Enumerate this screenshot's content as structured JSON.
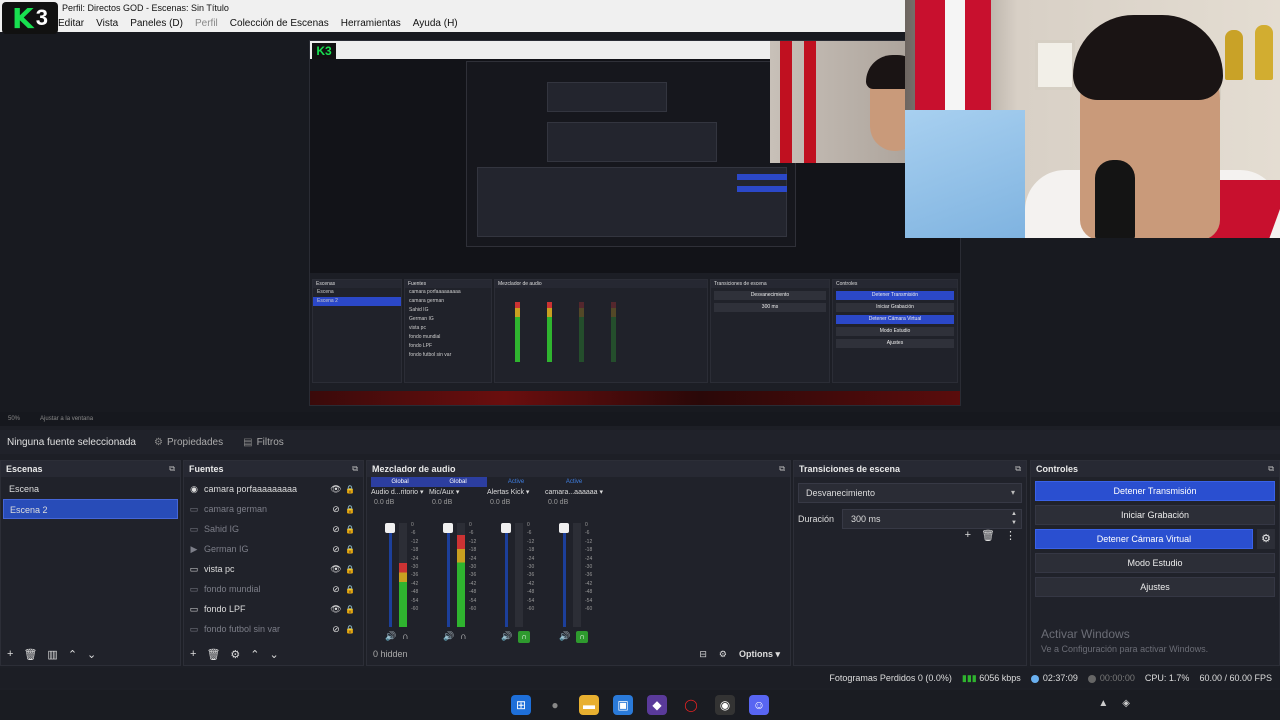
{
  "window": {
    "title": "Perfil: Directos GOD - Escenas: Sin Título",
    "logo_k": "K",
    "logo_num": "3"
  },
  "menubar": {
    "items": [
      "Editar",
      "Vista",
      "Paneles (D)",
      "Perfil",
      "Colección de Escenas",
      "Herramientas",
      "Ayuda (H)"
    ]
  },
  "zoom": {
    "level": "50%",
    "mode": "Ajustar a la ventana"
  },
  "source_toolbar": {
    "no_selection": "Ninguna fuente seleccionada",
    "properties": "Propiedades",
    "filters": "Filtros"
  },
  "scenes": {
    "title": "Escenas",
    "items": [
      "Escena",
      "Escena 2"
    ],
    "selected": "Escena 2"
  },
  "sources": {
    "title": "Fuentes",
    "items": [
      {
        "label": "camara porfaaaaaaaaa",
        "icon": "camera-icon",
        "visible": true,
        "locked": true
      },
      {
        "label": "camara german",
        "icon": "window-icon",
        "visible": false,
        "locked": true
      },
      {
        "label": "Sahid IG",
        "icon": "window-icon",
        "visible": false,
        "locked": true
      },
      {
        "label": "German IG",
        "icon": "play-icon",
        "visible": false,
        "locked": true
      },
      {
        "label": "vista pc",
        "icon": "window-icon",
        "visible": true,
        "locked": true
      },
      {
        "label": "fondo mundial",
        "icon": "window-icon",
        "visible": false,
        "locked": true
      },
      {
        "label": "fondo LPF",
        "icon": "window-icon",
        "visible": true,
        "locked": true
      },
      {
        "label": "fondo futbol sin var",
        "icon": "window-icon",
        "visible": false,
        "locked": true
      }
    ]
  },
  "mixer": {
    "title": "Mezclador de audio",
    "hidden_count": "0 hidden",
    "options_label": "Options",
    "channels": [
      {
        "badge": "Global",
        "name": "Audio d...ritorio",
        "db": "0.0 dB",
        "level": 0.62
      },
      {
        "badge": "Global",
        "name": "Mic/Aux",
        "db": "0.0 dB",
        "level": 0.88
      },
      {
        "badge": "Active",
        "name": "Alertas Kick",
        "db": "0.0 dB",
        "level": 0.0
      },
      {
        "badge": "Active",
        "name": "camara...aaaaaa",
        "db": "0.0 dB",
        "level": 0.0
      }
    ],
    "scale": [
      "0",
      "-6",
      "-12",
      "-18",
      "-24",
      "-30",
      "-36",
      "-42",
      "-48",
      "-54",
      "-60"
    ]
  },
  "transitions": {
    "title": "Transiciones de escena",
    "selected": "Desvanecimiento",
    "duration_label": "Duración",
    "duration_value": "300 ms"
  },
  "controls": {
    "title": "Controles",
    "stop_stream": "Detener Transmisión",
    "start_recording": "Iniciar Grabación",
    "stop_virtual_cam": "Detener Cámara Virtual",
    "studio_mode": "Modo Estudio",
    "settings": "Ajustes"
  },
  "activation": {
    "line1": "Activar Windows",
    "line2": "Ve a Configuración para activar Windows."
  },
  "status": {
    "dropped_frames": "Fotogramas Perdidos 0 (0.0%)",
    "bitrate": "6056 kbps",
    "stream_time": "02:37:09",
    "rec_time": "00:00:00",
    "cpu": "CPU: 1.7%",
    "fps": "60.00 / 60.00 FPS"
  },
  "colors": {
    "accent": "#2a4fd0",
    "selected": "#284cb8",
    "meter_green": "#2fb42f"
  }
}
